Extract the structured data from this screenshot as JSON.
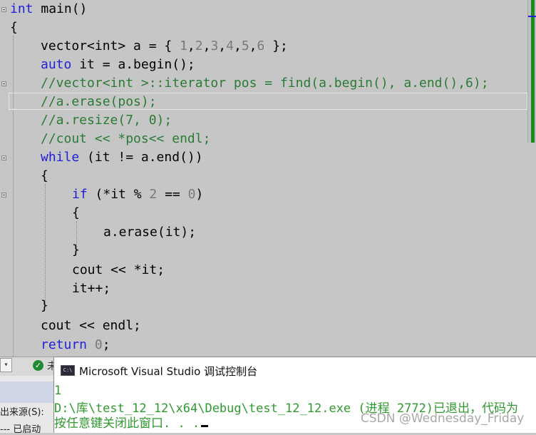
{
  "editor": {
    "lines": [
      [
        "int",
        " main()"
      ],
      [
        "{"
      ],
      [
        "vector<int> a = { ",
        "1",
        ",",
        "2",
        ",",
        "3",
        ",",
        "4",
        ",",
        "5",
        ",",
        "6",
        " };"
      ],
      [
        "auto",
        " it = a.begin();"
      ],
      [
        "//vector<int >::iterator pos = find(a.begin(), a.end(),6);"
      ],
      [
        "//a.erase(pos);"
      ],
      [
        "//a.resize(7, 0);"
      ],
      [
        "//cout << *pos<< endl;"
      ],
      [
        "while",
        " (it != a.end())"
      ],
      [
        "{"
      ],
      [
        "if",
        " (*it % ",
        "2",
        " == ",
        "0",
        ")"
      ],
      [
        "{"
      ],
      [
        "a.erase(it);"
      ],
      [
        "}"
      ],
      [
        "cout << *it;"
      ],
      [
        "it++;"
      ],
      [
        "}"
      ],
      [
        "cout << endl;"
      ],
      [
        "return",
        " ",
        "0",
        ";"
      ]
    ]
  },
  "statusbar": {
    "dropdown_glyph": "▾",
    "check_glyph": "✓",
    "text": "未"
  },
  "output_pane": {
    "source_label": "出来源(S):",
    "started_text": "--- 已启动"
  },
  "console": {
    "icon_text": "C:\\",
    "title": "Microsoft Visual Studio 调试控制台",
    "output_line1": "1",
    "output_line2": "D:\\库\\test_12_12\\x64\\Debug\\test_12_12.exe (进程 2772)已退出，代码为",
    "output_line3": "按任意键关闭此窗口. . .",
    "watermark": "CSDN @Wednesday_Friday"
  },
  "colors": {
    "keyword": "#2020d8",
    "comment": "#2b7a35",
    "number": "#7a7a7a",
    "console_text": "#2f9a2f",
    "scroll_green": "#1f8a1f"
  }
}
